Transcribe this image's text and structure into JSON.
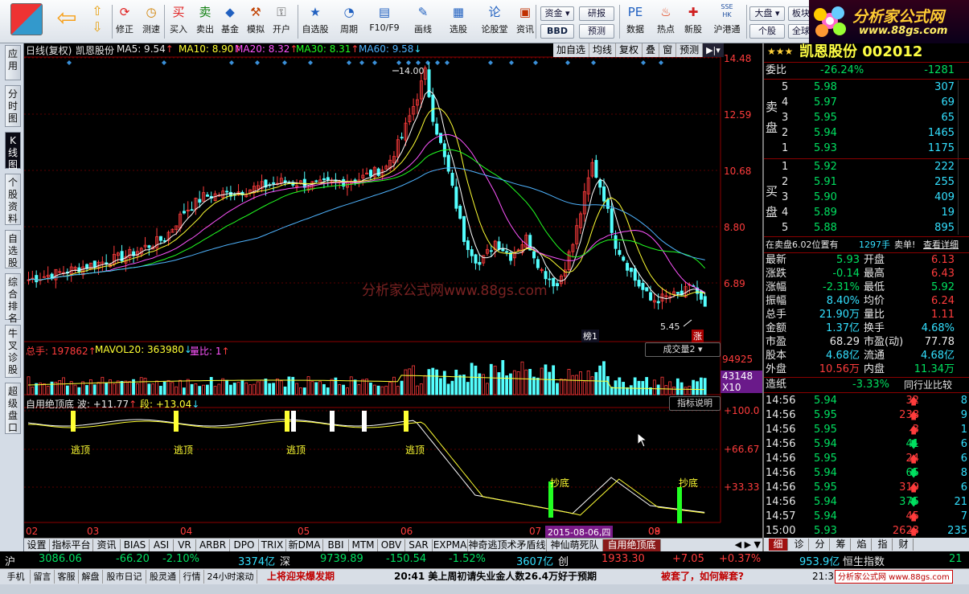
{
  "toolbar": {
    "items": [
      {
        "label": "修正",
        "icon": "refresh-icon"
      },
      {
        "label": "测速",
        "icon": "clock-icon"
      },
      {
        "label": "买入",
        "icon": "buy-icon",
        "glyph": "买"
      },
      {
        "label": "卖出",
        "icon": "sell-icon",
        "glyph": "卖"
      },
      {
        "label": "基金",
        "icon": "fund-icon"
      },
      {
        "label": "模拟",
        "icon": "hammer-icon"
      },
      {
        "label": "开户",
        "icon": "lock-icon"
      },
      {
        "label": "自选股",
        "icon": "star-icon"
      },
      {
        "label": "周期",
        "icon": "period-icon"
      },
      {
        "label": "F10/F9",
        "icon": "f10-icon"
      },
      {
        "label": "画线",
        "icon": "pencil-icon"
      },
      {
        "label": "选股",
        "icon": "select-icon"
      },
      {
        "label": "论股堂",
        "icon": "forum-icon",
        "glyph": "论"
      },
      {
        "label": "资讯",
        "icon": "news-icon"
      },
      {
        "label": "数据",
        "icon": "data-icon",
        "glyph": "PE"
      },
      {
        "label": "热点",
        "icon": "hot-icon"
      },
      {
        "label": "新股",
        "icon": "newstock-icon"
      },
      {
        "label": "沪港通",
        "icon": "hkconnect-icon",
        "glyph": "SSE HK"
      }
    ],
    "boxes": {
      "zijin": "资金",
      "bbd": "BBD",
      "yanbao": "研报",
      "yuce": "预测",
      "dapan": "大盘",
      "gegu": "个股",
      "bankuai": "板块",
      "quanqiu": "全球"
    },
    "logo": {
      "name": "分析家公式网",
      "url": "www.88gs.com"
    }
  },
  "leftbar": [
    "应用",
    "分时图",
    "K线图",
    "个股资料",
    "自选股",
    "综合排名",
    "牛叉诊股",
    "超级盘口"
  ],
  "chart": {
    "header": {
      "title": "日线(复权)",
      "stock": "凯恩股份",
      "ma5": "MA5: 9.54",
      "ma10": "MA10: 8.90",
      "ma20": "MA20: 8.32",
      "ma30": "MA30: 8.31",
      "ma60": "MA60: 9.58"
    },
    "buttons": [
      "加自选",
      "均线",
      "复权",
      "叠",
      "窗",
      "预测"
    ],
    "watermark": "分析家公式网www.88gs.com",
    "price_ticks": [
      "14.48",
      "12.59",
      "10.68",
      "8.80",
      "6.89"
    ],
    "high_label": "14.00",
    "low_label": "5.45",
    "tag_left": "榜1",
    "tag_right": "涨",
    "vol_header": {
      "label": "总手: 197862",
      "mavol": "MAVOL20: 363980",
      "ratio": "量比: 1"
    },
    "vol_button": "成交量2",
    "vol_ticks": [
      "94925",
      "43148",
      "X10"
    ],
    "ind_header": {
      "label": "自用绝顶底",
      "wave": "波: +11.77",
      "seg": "段: +13.04"
    },
    "ind_button": "指标说明",
    "ind_ticks": [
      "+100.0",
      "+66.67",
      "+33.33"
    ],
    "ind_labels": {
      "top": "逃顶",
      "bottom": "抄底"
    },
    "date_labels": [
      "02",
      "03",
      "04",
      "05",
      "06",
      "07",
      "08",
      "09"
    ],
    "cursor_date": "2015-08-06,四"
  },
  "tabs": [
    "设置",
    "指标平台",
    "资讯",
    "BIAS",
    "ASI",
    "VR",
    "ARBR",
    "DPO",
    "TRIX",
    "新DMA",
    "BBI",
    "MTM",
    "OBV",
    "SAR",
    "EXPMA",
    "神奇逃顶术矛盾线",
    "神仙萌死队",
    "自用绝顶底"
  ],
  "quote": {
    "name": "凯恩股份 002012",
    "webi_label": "委比",
    "webi": "-26.24%",
    "webc": "-1281",
    "sell_label": [
      "卖",
      "盘"
    ],
    "buy_label": [
      "买",
      "盘"
    ],
    "sells": [
      {
        "n": "5",
        "p": "5.98",
        "v": "307"
      },
      {
        "n": "4",
        "p": "5.97",
        "v": "69"
      },
      {
        "n": "3",
        "p": "5.95",
        "v": "65"
      },
      {
        "n": "2",
        "p": "5.94",
        "v": "1465"
      },
      {
        "n": "1",
        "p": "5.93",
        "v": "1175"
      }
    ],
    "buys": [
      {
        "n": "1",
        "p": "5.92",
        "v": "222"
      },
      {
        "n": "2",
        "p": "5.91",
        "v": "255"
      },
      {
        "n": "3",
        "p": "5.90",
        "v": "409"
      },
      {
        "n": "4",
        "p": "5.89",
        "v": "19"
      },
      {
        "n": "5",
        "p": "5.88",
        "v": "895"
      }
    ],
    "pos_line": {
      "a": "在卖盘6.02位置有",
      "b": "1297手",
      "c": "卖单!",
      "d": "查看详细"
    },
    "stats": [
      {
        "l1": "最新",
        "v1": "5.93",
        "l2": "开盘",
        "v2": "6.13"
      },
      {
        "l1": "涨跌",
        "v1": "-0.14",
        "l2": "最高",
        "v2": "6.43"
      },
      {
        "l1": "涨幅",
        "v1": "-2.31%",
        "l2": "最低",
        "v2": "5.92"
      },
      {
        "l1": "振幅",
        "v1": "8.40%",
        "l2": "均价",
        "v2": "6.24"
      },
      {
        "l1": "总手",
        "v1": "21.90万",
        "l2": "量比",
        "v2": "1.11"
      },
      {
        "l1": "金额",
        "v1": "1.37亿",
        "l2": "换手",
        "v2": "4.68%"
      },
      {
        "l1": "市盈",
        "v1": "68.29",
        "l2": "市盈(动)",
        "v2": "77.78"
      },
      {
        "l1": "股本",
        "v1": "4.68亿",
        "l2": "流通",
        "v2": "4.68亿"
      },
      {
        "l1": "外盘",
        "v1": "10.56万",
        "l2": "内盘",
        "v2": "11.34万"
      }
    ],
    "sector": {
      "name": "造纸",
      "chg": "-3.33%",
      "link": "同行业比较"
    },
    "ticks": [
      {
        "t": "14:56",
        "p": "5.94",
        "v": "32",
        "d": "up",
        "n": "8"
      },
      {
        "t": "14:56",
        "p": "5.95",
        "v": "238",
        "d": "up",
        "n": "9"
      },
      {
        "t": "14:56",
        "p": "5.95",
        "v": "3",
        "d": "up",
        "n": "1"
      },
      {
        "t": "14:56",
        "p": "5.94",
        "v": "41",
        "d": "down",
        "n": "6"
      },
      {
        "t": "14:56",
        "p": "5.95",
        "v": "24",
        "d": "up",
        "n": "6"
      },
      {
        "t": "14:56",
        "p": "5.94",
        "v": "65",
        "d": "down",
        "n": "8"
      },
      {
        "t": "14:56",
        "p": "5.95",
        "v": "319",
        "d": "up",
        "n": "6"
      },
      {
        "t": "14:56",
        "p": "5.94",
        "v": "375",
        "d": "down",
        "n": "21"
      },
      {
        "t": "14:57",
        "p": "5.94",
        "v": "45",
        "d": "up",
        "n": "7"
      },
      {
        "t": "15:00",
        "p": "5.93",
        "v": "2623",
        "d": "up",
        "n": "235"
      }
    ],
    "rtabs": [
      "细",
      "诊",
      "分",
      "筹",
      "焰",
      "指",
      "财"
    ]
  },
  "ticker": {
    "sh_label": "沪",
    "sh": "3086.06",
    "sh_chg": "-66.20",
    "sh_pct": "-2.10%",
    "sh_amt": "3374亿",
    "sz_label": "深",
    "sz": "9739.89",
    "sz_chg": "-150.54",
    "sz_pct": "-1.52%",
    "sz_amt": "3607亿",
    "cy_label": "创",
    "cy": "1933.30",
    "cy_chg": "+7.05",
    "cy_pct": "+0.37%",
    "hk_amt": "953.9亿",
    "hk_label": "恒生指数",
    "hk_val": "21"
  },
  "bottom": {
    "left": [
      "手机",
      "留言",
      "客服",
      "解盘",
      "股市日记",
      "股灵通",
      "行情",
      "24小时滚动"
    ],
    "news1": "上将迎来爆发期",
    "news2": "20:41 美上周初请失业金人数26.4万好于预期",
    "news3": "被套了，如何解套?",
    "time": "21:3",
    "logo": "分析家公式网 www.88gs.com"
  }
}
